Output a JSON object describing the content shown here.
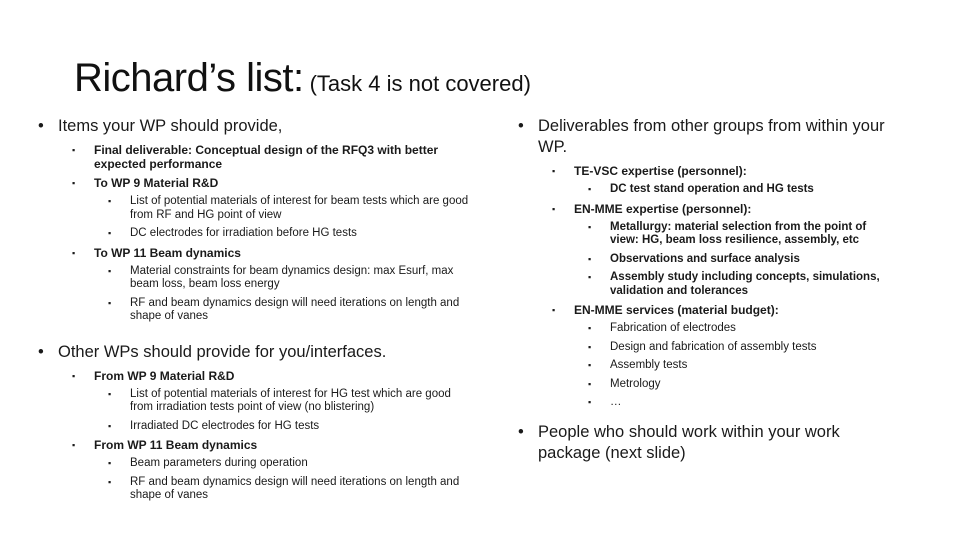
{
  "title": {
    "main": "Richard’s list:",
    "sub": "(Task 4 is not covered)"
  },
  "left": {
    "section1": {
      "heading": "Items your WP should provide,",
      "items": [
        {
          "text": "Final deliverable: Conceptual design of the RFQ3 with better expected performance",
          "children": []
        },
        {
          "text": "To WP 9 Material R&D",
          "children": [
            "List of potential materials of interest for beam tests which are good from RF and HG point of view",
            "DC electrodes for irradiation before HG tests"
          ]
        },
        {
          "text": "To WP 11 Beam dynamics",
          "children": [
            "Material constraints for beam dynamics design: max Esurf, max beam loss, beam loss energy",
            "RF and beam dynamics design will need iterations on length and shape of vanes"
          ]
        }
      ]
    },
    "section2": {
      "heading": "Other WPs should provide for you/interfaces.",
      "items": [
        {
          "text": "From WP 9 Material R&D",
          "children": [
            "List of potential materials of interest for HG test which are good from irradiation tests point of view (no blistering)",
            "Irradiated DC electrodes for HG tests"
          ]
        },
        {
          "text": "From WP 11 Beam dynamics",
          "children": [
            "Beam parameters during operation",
            "RF and beam dynamics design will need iterations on length and shape of vanes"
          ]
        }
      ]
    }
  },
  "right": {
    "section1": {
      "heading": "Deliverables from other groups from within your WP.",
      "items": [
        {
          "text": "TE-VSC expertise (personnel):",
          "children": [
            "DC test stand operation and HG tests"
          ]
        },
        {
          "text": "EN-MME expertise (personnel):",
          "children": [
            "Metallurgy: material selection from the point of view: HG, beam loss resilience, assembly, etc",
            "Observations and surface analysis",
            "Assembly study including concepts, simulations, validation and tolerances"
          ]
        },
        {
          "text": "EN-MME services (material budget):",
          "children": [
            "Fabrication of electrodes",
            "Design and fabrication of assembly tests",
            "Assembly tests",
            "Metrology",
            "…"
          ]
        }
      ]
    },
    "section2": {
      "heading": "People who should work within your work package (next slide)"
    }
  },
  "bullets": {
    "level1": "•",
    "level2": "▪"
  }
}
